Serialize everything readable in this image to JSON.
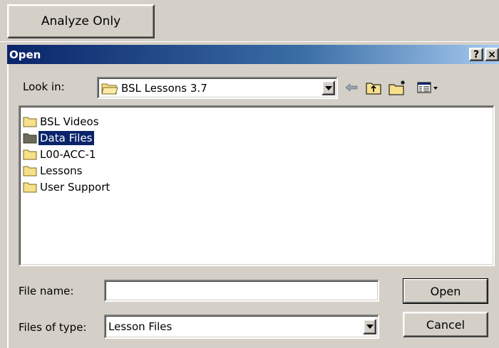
{
  "toolbar": {
    "analyze_label": "Analyze Only"
  },
  "dialog": {
    "title": "Open",
    "help_label": "?",
    "close_label": "×",
    "look_in_label": "Look in:",
    "look_in_value": "BSL Lessons 3.7",
    "toolbar_icons": [
      "back-arrow-icon",
      "up-folder-icon",
      "new-folder-icon",
      "view-menu-icon"
    ],
    "files": [
      {
        "name": "BSL Videos",
        "icon": "folder-icon",
        "selected": false
      },
      {
        "name": "Data Files",
        "icon": "folder-icon",
        "selected": true
      },
      {
        "name": "L00-ACC-1",
        "icon": "folder-icon",
        "selected": false
      },
      {
        "name": "Lessons",
        "icon": "folder-icon",
        "selected": false
      },
      {
        "name": "User Support",
        "icon": "folder-icon",
        "selected": false
      }
    ],
    "file_name_label": "File name:",
    "file_name_value": "",
    "files_of_type_label": "Files of type:",
    "files_of_type_value": "Lesson Files",
    "open_label": "Open",
    "cancel_label": "Cancel"
  },
  "colors": {
    "face": "#d4d0c8",
    "title_start": "#0a246a",
    "title_end": "#a6caf0",
    "selection": "#0a246a",
    "folder": "#f6e08a"
  }
}
